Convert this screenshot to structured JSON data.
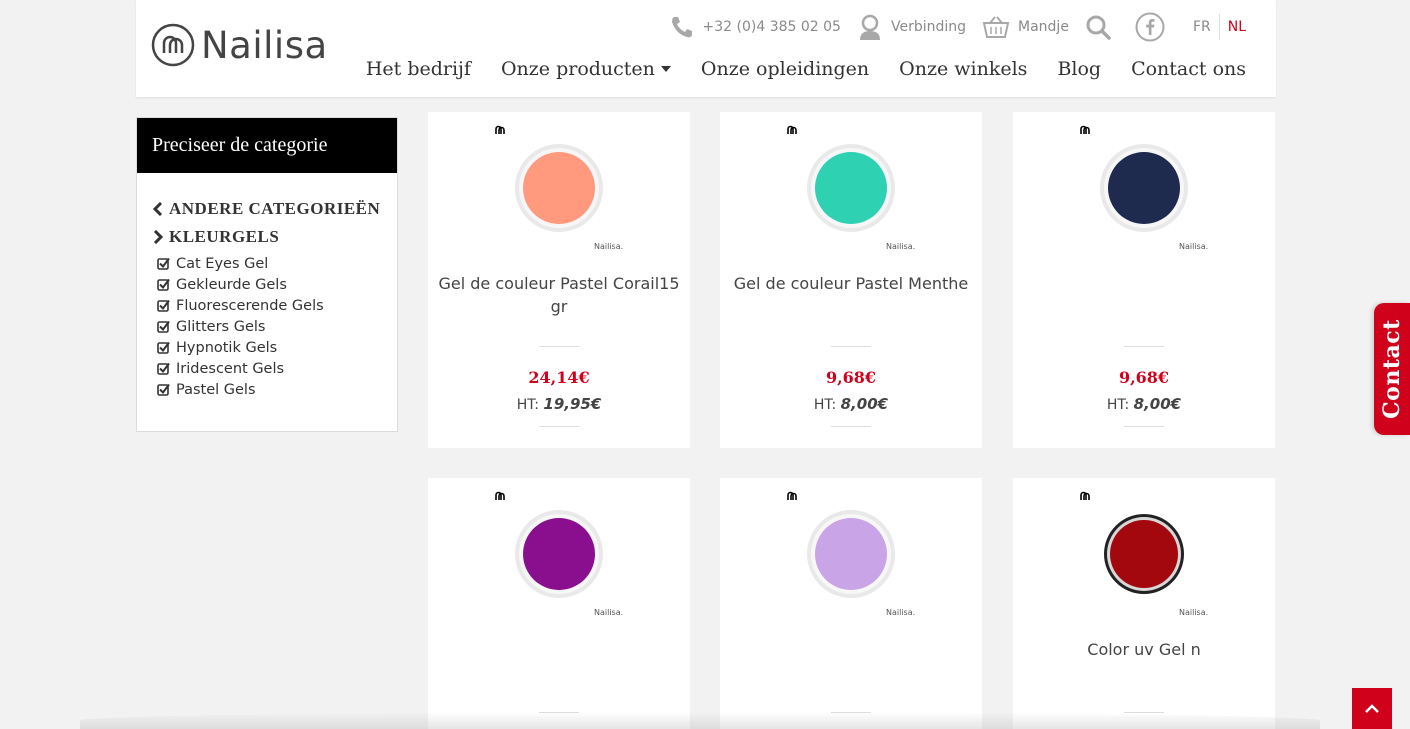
{
  "brand": {
    "name": "Nailisa"
  },
  "topbar": {
    "phone": "+32 (0)4 385 02 05",
    "login": "Verbinding",
    "cart": "Mandje",
    "lang_fr": "FR",
    "lang_nl": "NL"
  },
  "nav": {
    "items": [
      "Het bedrijf",
      "Onze producten",
      "Onze opleidingen",
      "Onze winkels",
      "Blog",
      "Contact ons"
    ]
  },
  "sidebar": {
    "title": "Preciseer de categorie",
    "back_link": "ANDERE CATEGORIEËN",
    "current_link": "KLEURGELS",
    "subcategories": [
      "Cat Eyes Gel",
      "Gekleurde Gels",
      "Fluorescerende Gels",
      "Glitters Gels",
      "Hypnotik Gels",
      "Iridescent Gels",
      "Pastel Gels"
    ]
  },
  "products": [
    {
      "title": "Gel de couleur Pastel Corail15 gr",
      "price": "24,14€",
      "ht_label": "HT:",
      "ht_value": "19,95€",
      "jar_color": "#ff9a7e",
      "jar_brand": "Nailisa."
    },
    {
      "title": "Gel de couleur Pastel Menthe",
      "price": "9,68€",
      "ht_label": "HT:",
      "ht_value": "8,00€",
      "jar_color": "#2fd1b3",
      "jar_brand": "Nailisa."
    },
    {
      "title": "",
      "price": "9,68€",
      "ht_label": "HT:",
      "ht_value": "8,00€",
      "jar_color": "#1f2a4f",
      "jar_brand": "Nailisa."
    },
    {
      "title": "",
      "price": "",
      "ht_label": "",
      "ht_value": "",
      "jar_color": "#8a0f8f",
      "jar_brand": "Nailisa."
    },
    {
      "title": "",
      "price": "",
      "ht_label": "",
      "ht_value": "",
      "jar_color": "#c9a4e6",
      "jar_brand": "Nailisa."
    },
    {
      "title": "Color uv Gel n",
      "price": "",
      "ht_label": "",
      "ht_value": "",
      "jar_color": "#a3080e",
      "jar_brand": "Nailisa."
    }
  ],
  "contact_tab": "Contact",
  "colors": {
    "accent": "#d0021b",
    "sidebar_head": "#000000",
    "background": "#f2f2f2"
  }
}
